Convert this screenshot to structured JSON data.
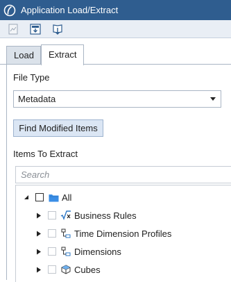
{
  "window": {
    "title": "Application Load/Extract"
  },
  "toolbar": {
    "buttons": [
      {
        "icon": "import-icon"
      },
      {
        "icon": "load-icon"
      },
      {
        "icon": "extract-icon"
      }
    ]
  },
  "tabs": [
    {
      "label": "Load",
      "active": false
    },
    {
      "label": "Extract",
      "active": true
    }
  ],
  "file_type": {
    "label": "File Type",
    "value": "Metadata"
  },
  "find_button": {
    "label": "Find Modified Items"
  },
  "items": {
    "label": "Items To Extract",
    "search_placeholder": "Search",
    "tree": [
      {
        "label": "All",
        "icon": "folder-icon",
        "expanded": true,
        "checked": false
      },
      {
        "label": "Business Rules",
        "icon": "business-rules-icon",
        "expanded": false,
        "checked": false
      },
      {
        "label": "Time Dimension Profiles",
        "icon": "hierarchy-icon",
        "expanded": false,
        "checked": false
      },
      {
        "label": "Dimensions",
        "icon": "hierarchy-icon",
        "expanded": false,
        "checked": false
      },
      {
        "label": "Cubes",
        "icon": "cube-icon",
        "expanded": false,
        "checked": false
      }
    ]
  },
  "colors": {
    "titlebar": "#2f5d8f",
    "toolbar": "#e9eef5",
    "button": "#dbe6f4",
    "folder": "#3a8ee6"
  }
}
